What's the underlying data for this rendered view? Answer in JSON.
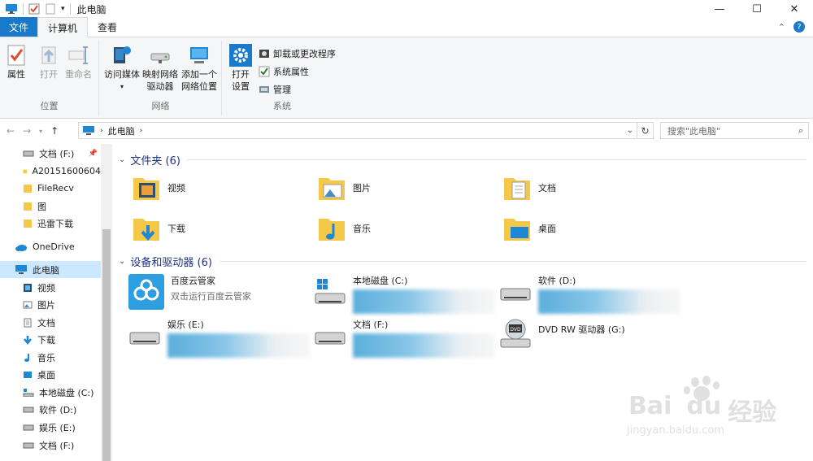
{
  "titlebar": {
    "title": "此电脑",
    "minimize": "—",
    "maximize": "☐",
    "close": "✕"
  },
  "tabs": [
    {
      "label": "文件"
    },
    {
      "label": "计算机"
    },
    {
      "label": "查看"
    }
  ],
  "ribbon": {
    "location": {
      "label": "位置",
      "properties": "属性",
      "open": "打开",
      "rename": "重命名"
    },
    "network": {
      "label": "网络",
      "access_media": "访问媒体",
      "map_drive_1": "映射网络",
      "map_drive_2": "驱动器",
      "add_location_1": "添加一个",
      "add_location_2": "网络位置"
    },
    "system": {
      "label": "系统",
      "open_settings_1": "打开",
      "open_settings_2": "设置",
      "uninstall": "卸载或更改程序",
      "sys_props": "系统属性",
      "manage": "管理"
    }
  },
  "address": {
    "path": "此电脑",
    "search_placeholder": "搜索\"此电脑\""
  },
  "sidebar": {
    "items": [
      {
        "label": "文档 (F:)"
      },
      {
        "label": "A20151600604"
      },
      {
        "label": "FileRecv"
      },
      {
        "label": "图"
      },
      {
        "label": "迅雷下载"
      },
      {
        "label": "OneDrive"
      },
      {
        "label": "此电脑"
      },
      {
        "label": "视频"
      },
      {
        "label": "图片"
      },
      {
        "label": "文档"
      },
      {
        "label": "下载"
      },
      {
        "label": "音乐"
      },
      {
        "label": "桌面"
      },
      {
        "label": "本地磁盘 (C:)"
      },
      {
        "label": "软件 (D:)"
      },
      {
        "label": "娱乐 (E:)"
      },
      {
        "label": "文档 (F:)"
      }
    ]
  },
  "folders": {
    "header": "文件夹 (6)",
    "items": [
      {
        "label": "视频"
      },
      {
        "label": "图片"
      },
      {
        "label": "文档"
      },
      {
        "label": "下载"
      },
      {
        "label": "音乐"
      },
      {
        "label": "桌面"
      }
    ]
  },
  "devices": {
    "header": "设备和驱动器 (6)",
    "items": [
      {
        "label": "百度云管家",
        "sub": "双击运行百度云管家"
      },
      {
        "label": "本地磁盘 (C:)"
      },
      {
        "label": "软件 (D:)"
      },
      {
        "label": "娱乐 (E:)"
      },
      {
        "label": "文档 (F:)"
      },
      {
        "label": "DVD RW 驱动器 (G:)"
      }
    ]
  },
  "watermark": {
    "brand": "Bai",
    "brand2": "du",
    "cn": "经验",
    "url": "jingyan.baidu.com"
  },
  "colors": {
    "accent": "#1979ca",
    "selected": "#cce8ff",
    "folder": "#f5c84a",
    "section": "#1e3287"
  }
}
